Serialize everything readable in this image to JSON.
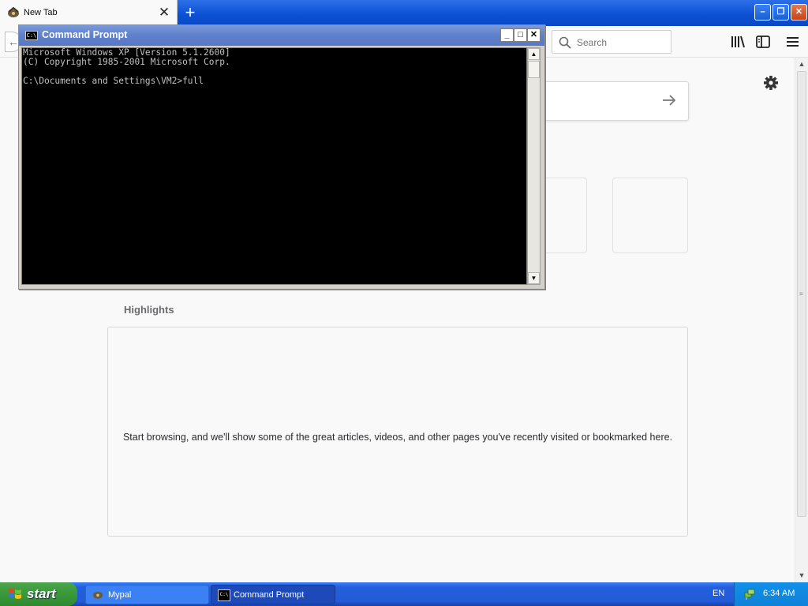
{
  "browser": {
    "tab_title": "New Tab",
    "tab_close": "✕",
    "new_tab": "+",
    "back": "←",
    "search_placeholder": "Search",
    "window_controls": {
      "minimize": "–",
      "maximize": "❐",
      "close": "✕"
    },
    "icons": [
      "library-icon",
      "sidebar-icon",
      "menu-icon",
      "gear-icon",
      "arrow-right-icon"
    ]
  },
  "newtab": {
    "highlights_title": "Highlights",
    "highlights_empty": "Start browsing, and we'll show some of the great articles, videos, and other pages you've recently visited or bookmarked here."
  },
  "cmd": {
    "title": "Command Prompt",
    "icon_text": "C:\\",
    "controls": {
      "minimize": "_",
      "maximize": "□",
      "close": "✕"
    },
    "output": "Microsoft Windows XP [Version 5.1.2600]\n(C) Copyright 1985-2001 Microsoft Corp.\n\nC:\\Documents and Settings\\VM2>full"
  },
  "taskbar": {
    "start_label": "start",
    "tasks": [
      {
        "label": "Mypal",
        "active": false
      },
      {
        "label": "Command Prompt",
        "active": true
      }
    ],
    "language": "EN",
    "clock": "6:34 AM"
  },
  "colors": {
    "xp_blue": "#245edc",
    "start_green": "#3c9a3c",
    "console_bg": "#000000",
    "console_fg": "#c0c0c0",
    "page_bg": "#f9f9fa"
  }
}
